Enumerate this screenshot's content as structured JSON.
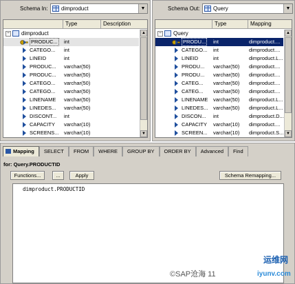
{
  "schema_in": {
    "label": "Schema In:",
    "value": "dimproduct",
    "columns": [
      "Type",
      "Description"
    ],
    "root": "dimproduct",
    "rows": [
      {
        "name": "PRODUC...",
        "type": "int",
        "key": true
      },
      {
        "name": "CATEGO...",
        "type": "int"
      },
      {
        "name": "LINEID",
        "type": "int"
      },
      {
        "name": "PRODUC...",
        "type": "varchar(50)"
      },
      {
        "name": "PRODUC...",
        "type": "varchar(50)"
      },
      {
        "name": "CATEGO...",
        "type": "varchar(50)"
      },
      {
        "name": "CATEGO...",
        "type": "varchar(50)"
      },
      {
        "name": "LINENAME",
        "type": "varchar(50)"
      },
      {
        "name": "LINEDES...",
        "type": "varchar(50)"
      },
      {
        "name": "DISCONT...",
        "type": "int"
      },
      {
        "name": "CAPACITY",
        "type": "varchar(10)"
      },
      {
        "name": "SCREENS...",
        "type": "varchar(10)"
      }
    ]
  },
  "schema_out": {
    "label": "Schema Out:",
    "value": "Query",
    "columns": [
      "Type",
      "Mapping"
    ],
    "root": "Query",
    "rows": [
      {
        "name": "PRODU...",
        "type": "int",
        "mapping": "dimproduct....",
        "key": true
      },
      {
        "name": "CATEGO...",
        "type": "int",
        "mapping": "dimproduct...."
      },
      {
        "name": "LINEID",
        "type": "int",
        "mapping": "dimproduct.L..."
      },
      {
        "name": "PRODU...",
        "type": "varchar(50)",
        "mapping": "dimproduct...."
      },
      {
        "name": "PRODU...",
        "type": "varchar(50)",
        "mapping": "dimproduct...."
      },
      {
        "name": "CATEG...",
        "type": "varchar(50)",
        "mapping": "dimproduct...."
      },
      {
        "name": "CATEG...",
        "type": "varchar(50)",
        "mapping": "dimproduct...."
      },
      {
        "name": "LINENAME",
        "type": "varchar(50)",
        "mapping": "dimproduct.L..."
      },
      {
        "name": "LINEDES...",
        "type": "varchar(50)",
        "mapping": "dimproduct.L..."
      },
      {
        "name": "DISCON...",
        "type": "int",
        "mapping": "dimproduct.D..."
      },
      {
        "name": "CAPACITY",
        "type": "varchar(10)",
        "mapping": "dimproduct...."
      },
      {
        "name": "SCREEN...",
        "type": "varchar(10)",
        "mapping": "dimproduct.S..."
      }
    ]
  },
  "tabs": [
    "Mapping",
    "SELECT",
    "FROM",
    "WHERE",
    "GROUP BY",
    "ORDER BY",
    "Advanced",
    "Find"
  ],
  "mapping": {
    "for_label": "for: Query.PRODUCTID",
    "functions_button": "Functions...",
    "dots_button": "...",
    "apply_button": "Apply",
    "schema_remapping_button": "Schema Remapping...",
    "expression": "dimproduct.PRODUCTID"
  },
  "watermark": {
    "text": "©SAP沧海 11",
    "logo_top": "运维网",
    "logo_bottom": "iyunv.com"
  },
  "colors": {
    "selection": "#0a246a",
    "panel": "#d4d0c8",
    "icon_blue": "#1f4f9e"
  }
}
